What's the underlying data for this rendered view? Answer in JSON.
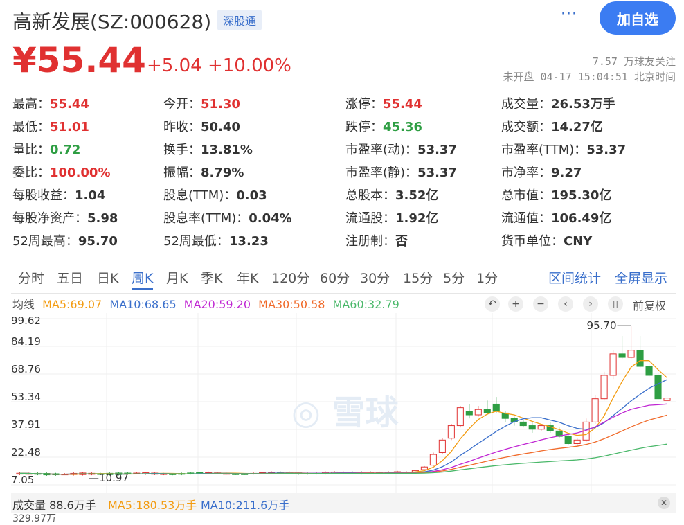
{
  "header": {
    "title": "高新发展(SZ:000628)",
    "tag": "深股通",
    "more_icon": "···",
    "follow_label": "加自选"
  },
  "quote": {
    "price": "¥55.44",
    "change": "+5.04 +10.00%",
    "followers": "7.57 万球友关注",
    "status_time": "未开盘 04-17 15:04:51 北京时间"
  },
  "stats": [
    [
      {
        "label": "最高：",
        "value": "55.44",
        "color": "red"
      },
      {
        "label": "今开：",
        "value": "51.30",
        "color": "red"
      },
      {
        "label": "涨停：",
        "value": "55.44",
        "color": "red"
      },
      {
        "label": "成交量：",
        "value": "26.53万手",
        "color": ""
      }
    ],
    [
      {
        "label": "最低：",
        "value": "51.01",
        "color": "red"
      },
      {
        "label": "昨收：",
        "value": "50.40",
        "color": ""
      },
      {
        "label": "跌停：",
        "value": "45.36",
        "color": "green"
      },
      {
        "label": "成交额：",
        "value": "14.27亿",
        "color": ""
      }
    ],
    [
      {
        "label": "量比：",
        "value": "0.72",
        "color": "green"
      },
      {
        "label": "换手：",
        "value": "13.81%",
        "color": ""
      },
      {
        "label": "市盈率(动)：",
        "value": "53.37",
        "color": ""
      },
      {
        "label": "市盈率(TTM)：",
        "value": "53.37",
        "color": ""
      }
    ],
    [
      {
        "label": "委比：",
        "value": "100.00%",
        "color": "red"
      },
      {
        "label": "振幅：",
        "value": "8.79%",
        "color": ""
      },
      {
        "label": "市盈率(静)：",
        "value": "53.37",
        "color": ""
      },
      {
        "label": "市净率：",
        "value": "9.27",
        "color": ""
      }
    ],
    [
      {
        "label": "每股收益：",
        "value": "1.04",
        "color": ""
      },
      {
        "label": "股息(TTM)：",
        "value": "0.03",
        "color": ""
      },
      {
        "label": "总股本：",
        "value": "3.52亿",
        "color": ""
      },
      {
        "label": "总市值：",
        "value": "195.30亿",
        "color": ""
      }
    ],
    [
      {
        "label": "每股净资产：",
        "value": "5.98",
        "color": ""
      },
      {
        "label": "股息率(TTM)：",
        "value": "0.04%",
        "color": ""
      },
      {
        "label": "流通股：",
        "value": "1.92亿",
        "color": ""
      },
      {
        "label": "流通值：",
        "value": "106.49亿",
        "color": ""
      }
    ],
    [
      {
        "label": "52周最高：",
        "value": "95.70",
        "color": ""
      },
      {
        "label": "52周最低：",
        "value": "13.23",
        "color": ""
      },
      {
        "label": "注册制：",
        "value": "否",
        "color": ""
      },
      {
        "label": "货币单位：",
        "value": "CNY",
        "color": ""
      }
    ]
  ],
  "tabs": [
    "分时",
    "五日",
    "日K",
    "周K",
    "月K",
    "季K",
    "年K",
    "120分",
    "60分",
    "30分",
    "15分",
    "5分",
    "1分"
  ],
  "active_tab": "周K",
  "right_tabs": [
    "区间统计",
    "全屏显示"
  ],
  "ma": {
    "label": "均线",
    "ma5": "MA5:69.07",
    "ma10": "MA10:68.65",
    "ma20": "MA20:59.20",
    "ma30": "MA30:50.58",
    "ma60": "MA60:32.79"
  },
  "tools": {
    "undo_icon": "↶",
    "zoom_in_icon": "+",
    "zoom_out_icon": "−",
    "prev_icon": "‹",
    "next_icon": "›",
    "candle_icon": "▯",
    "adjust_label": "前复权"
  },
  "chart": {
    "y_labels": [
      "99.62",
      "84.19",
      "68.76",
      "53.34",
      "37.91",
      "22.48",
      "7.05"
    ],
    "high_annotation": "95.70",
    "low_annotation": "10.97",
    "watermark": "雪球"
  },
  "volume": {
    "label": "成交量 88.6万手",
    "ma5": "MA5:180.53万手",
    "ma10": "MA10:211.6万手",
    "sub": "329.97万"
  },
  "colors": {
    "up": "#e03131",
    "down": "#2e9e43",
    "accent": "#3a6fcb",
    "ma5": "#f39c12",
    "ma10": "#3a6fcb",
    "ma20": "#c026d3",
    "ma30": "#f06a2a",
    "ma60": "#4ab86a"
  }
}
